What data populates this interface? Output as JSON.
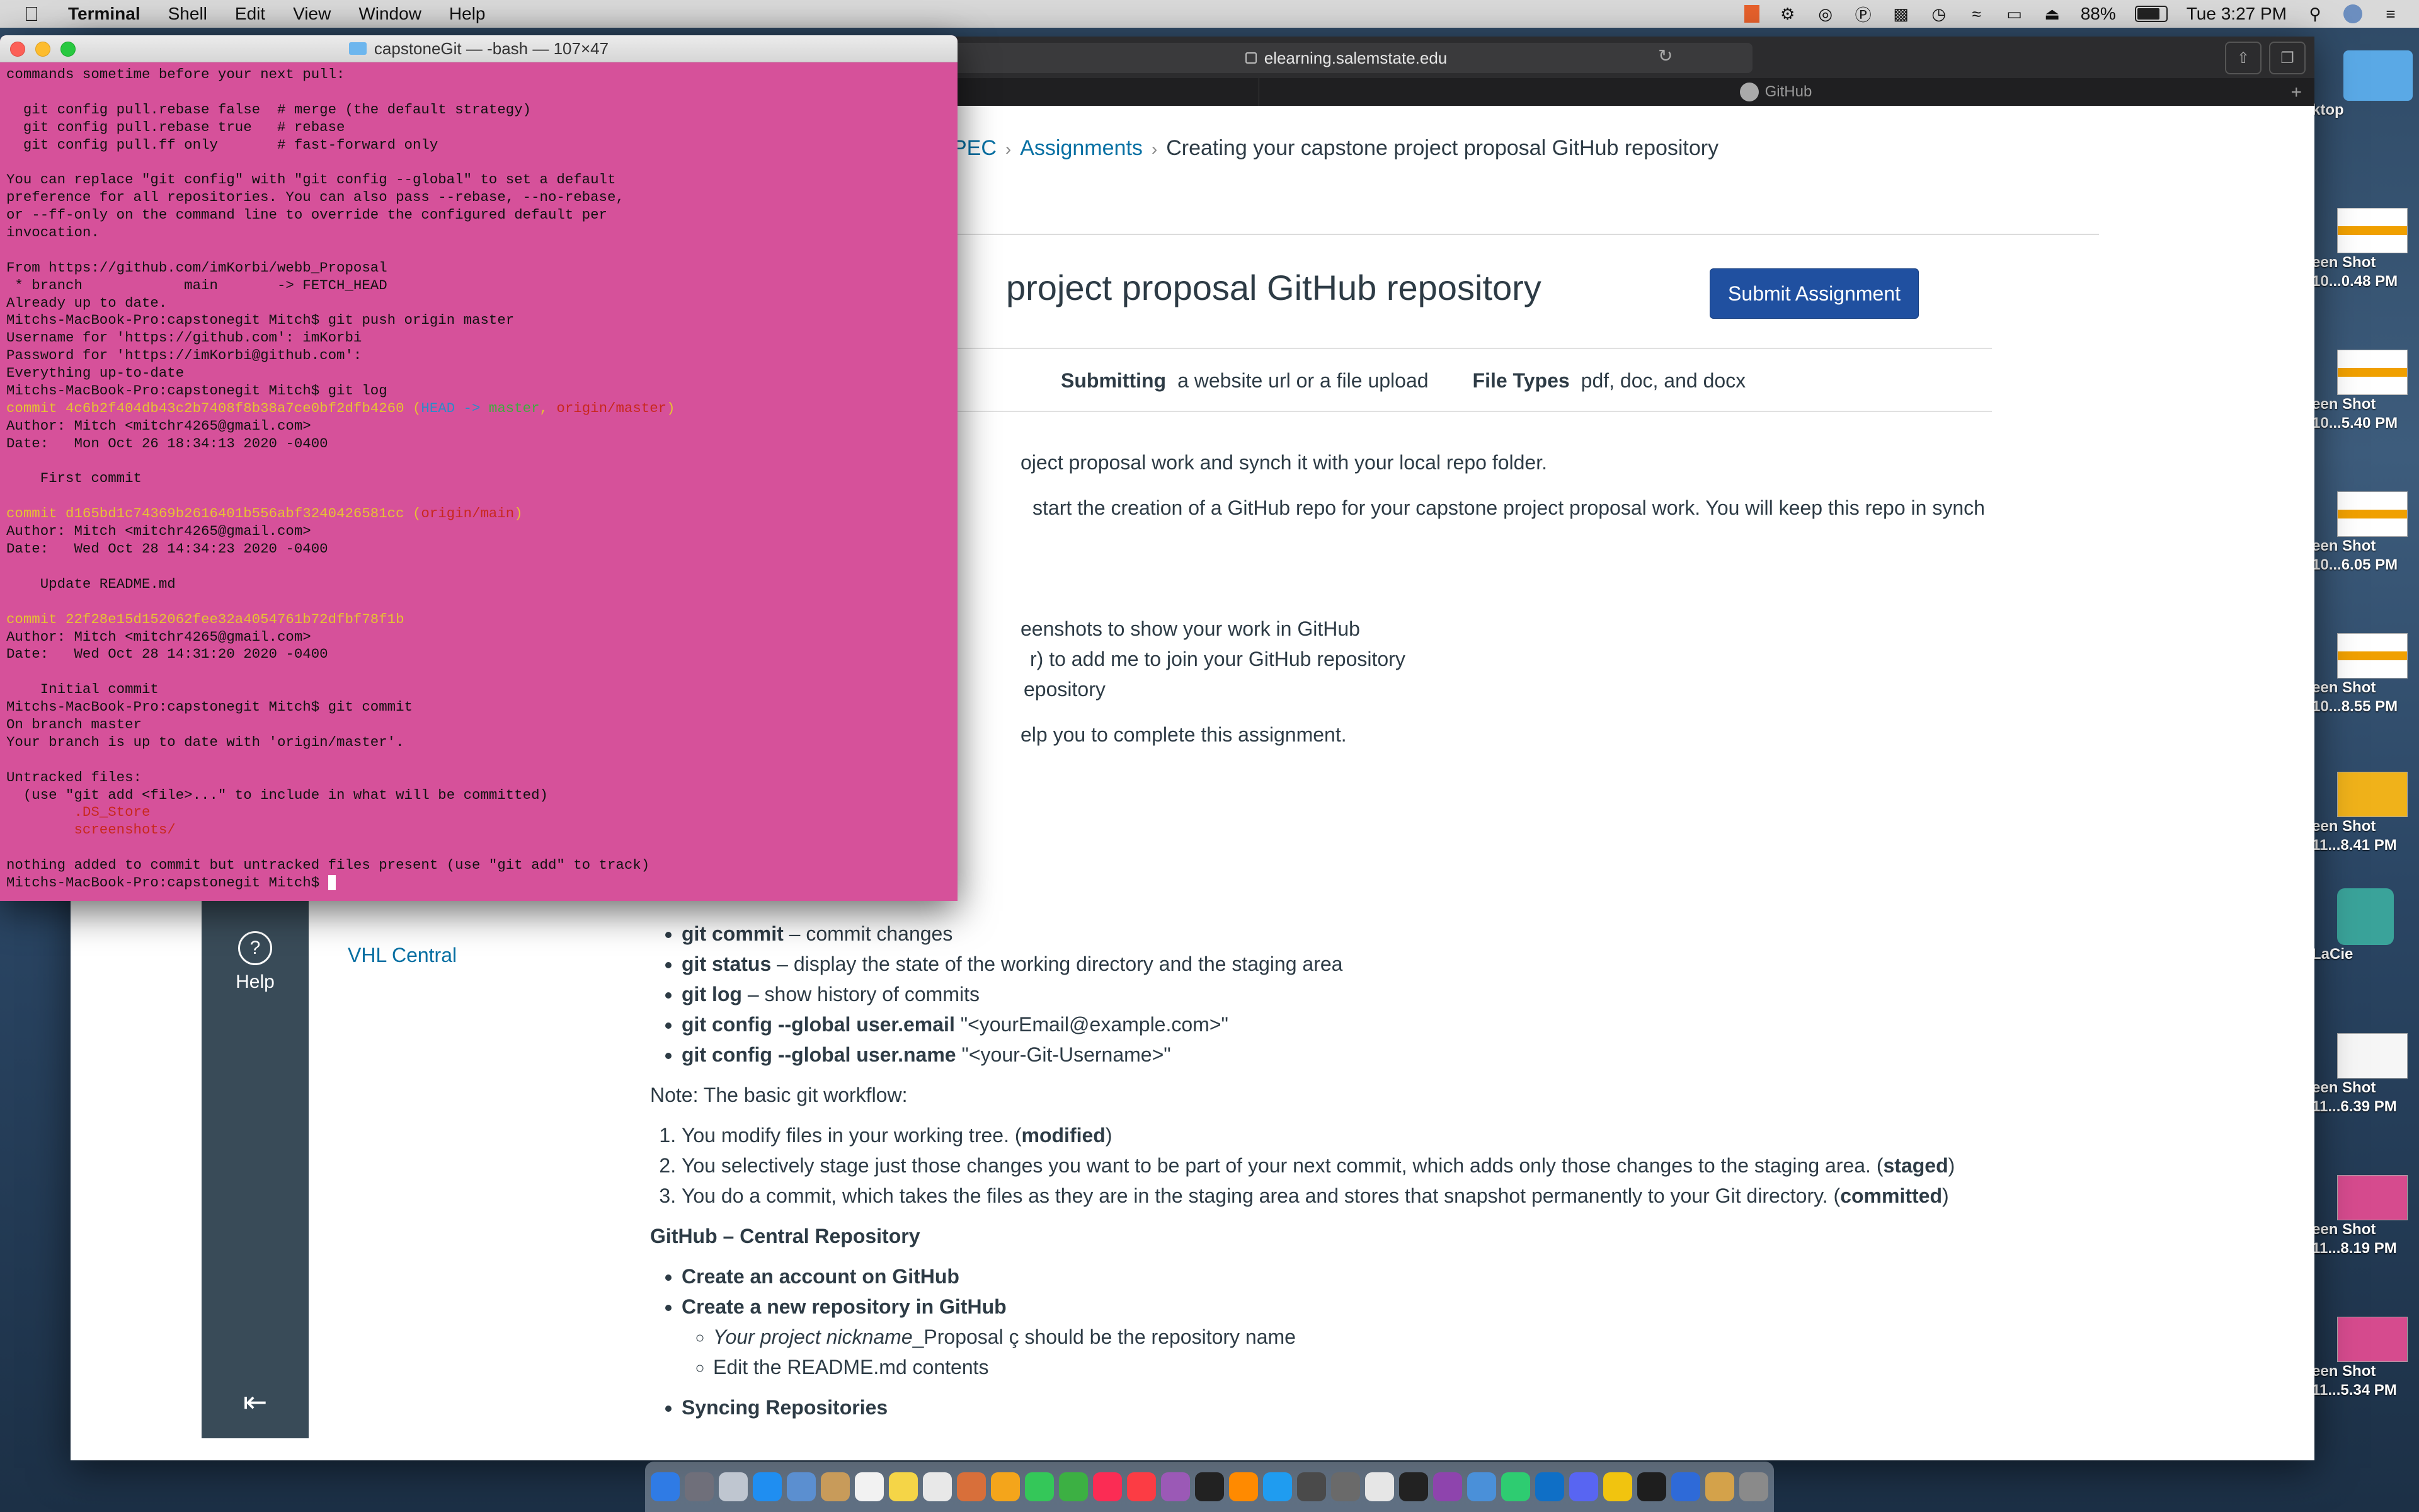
{
  "menubar": {
    "app": "Terminal",
    "items": [
      "Shell",
      "Edit",
      "View",
      "Window",
      "Help"
    ],
    "battery": "88%",
    "battery_level": 0.88,
    "clock": "Tue 3:27 PM"
  },
  "browser": {
    "url": "elearning.salemstate.edu",
    "tabs": [
      "",
      "GitHub"
    ]
  },
  "canvas": {
    "breadcrumb": [
      "PEC",
      "Assignments",
      "Creating your capstone project proposal GitHub repository"
    ],
    "title": "project proposal GitHub repository",
    "submit_button": "Submit Assignment",
    "meta": {
      "submitting_label": "Submitting",
      "submitting_value": "a website url or a file upload",
      "filetypes_label": "File Types",
      "filetypes_value": "pdf, doc, and docx"
    },
    "visible_lines": [
      "oject proposal work and synch it with your local repo folder.",
      "start the creation of a GitHub repo for your capstone project proposal work. You will keep this repo in synch",
      "eenshots to show your work in GitHub",
      "r) to add me to join your GitHub repository",
      "epository",
      "elp you to complete this assignment."
    ],
    "help_label": "Help",
    "course_nav_item": "VHL Central",
    "commands": [
      {
        "cmd": "git commit",
        "desc": " – commit changes"
      },
      {
        "cmd": "git status",
        "desc": " – display the state of the working directory and the staging area"
      },
      {
        "cmd": "git log",
        "desc": " – show history of commits"
      },
      {
        "cmd": "git config --global user.email",
        "desc": " \"<yourEmail@example.com>\""
      },
      {
        "cmd": "git config --global user.name",
        "desc": " \"<your-Git-Username>\""
      }
    ],
    "note": "Note: The basic git workflow:",
    "workflow": [
      {
        "text": "You modify files in your working tree. (",
        "bold": "modified",
        "end": ")"
      },
      {
        "text": "You selectively stage just those changes you want to be part of your next commit, which adds only those changes to the staging area. (",
        "bold": "staged",
        "end": ")"
      },
      {
        "text": "You do a commit, which takes the files as they are in the staging area and stores that snapshot permanently to your Git directory. (",
        "bold": "committed",
        "end": ")"
      }
    ],
    "central_heading": "GitHub – Central Repository",
    "github_items": [
      "Create an account on GitHub",
      "Create a new repository in GitHub"
    ],
    "github_subitems": [
      {
        "em": "Your project nickname",
        "text": "_Proposal ç should be the repository name"
      },
      {
        "em": "",
        "text": "Edit the README.md contents"
      }
    ],
    "syncing": "Syncing Repositories"
  },
  "terminal": {
    "title": "capstoneGit — -bash — 107×47",
    "lines": [
      [
        {
          "t": "commands sometime before your next pull:"
        }
      ],
      [
        {
          "t": ""
        }
      ],
      [
        {
          "t": "  git config pull.rebase false  # merge (the default strategy)"
        }
      ],
      [
        {
          "t": "  git config pull.rebase true   # rebase"
        }
      ],
      [
        {
          "t": "  git config pull.ff only       # fast-forward only"
        }
      ],
      [
        {
          "t": ""
        }
      ],
      [
        {
          "t": "You can replace \"git config\" with \"git config --global\" to set a default"
        }
      ],
      [
        {
          "t": "preference for all repositories. You can also pass --rebase, --no-rebase,"
        }
      ],
      [
        {
          "t": "or --ff-only on the command line to override the configured default per"
        }
      ],
      [
        {
          "t": "invocation."
        }
      ],
      [
        {
          "t": ""
        }
      ],
      [
        {
          "t": "From https://github.com/imKorbi/webb_Proposal"
        }
      ],
      [
        {
          "t": " * branch            main       -> FETCH_HEAD"
        }
      ],
      [
        {
          "t": "Already up to date."
        }
      ],
      [
        {
          "t": "Mitchs-MacBook-Pro:capstonegit Mitch$ git push origin master"
        }
      ],
      [
        {
          "t": "Username for 'https://github.com': imKorbi"
        }
      ],
      [
        {
          "t": "Password for 'https://imKorbi@github.com':"
        }
      ],
      [
        {
          "t": "Everything up-to-date"
        }
      ],
      [
        {
          "t": "Mitchs-MacBook-Pro:capstonegit Mitch$ git log"
        }
      ],
      [
        {
          "t": "commit 4c6b2f404db43c2b7408f8b38a7ce0bf2dfb4260 (",
          "c": "yellow"
        },
        {
          "t": "HEAD -> ",
          "c": "cyan"
        },
        {
          "t": "master",
          "c": "green"
        },
        {
          "t": ", ",
          "c": "yellow"
        },
        {
          "t": "origin/master",
          "c": "red"
        },
        {
          "t": ")",
          "c": "yellow"
        }
      ],
      [
        {
          "t": "Author: Mitch <mitchr4265@gmail.com>"
        }
      ],
      [
        {
          "t": "Date:   Mon Oct 26 18:34:13 2020 -0400"
        }
      ],
      [
        {
          "t": ""
        }
      ],
      [
        {
          "t": "    First commit"
        }
      ],
      [
        {
          "t": ""
        }
      ],
      [
        {
          "t": "commit d165bd1c74369b2616401b556abf3240426581cc (",
          "c": "yellow"
        },
        {
          "t": "origin/main",
          "c": "red"
        },
        {
          "t": ")",
          "c": "yellow"
        }
      ],
      [
        {
          "t": "Author: Mitch <mitchr4265@gmail.com>"
        }
      ],
      [
        {
          "t": "Date:   Wed Oct 28 14:34:23 2020 -0400"
        }
      ],
      [
        {
          "t": ""
        }
      ],
      [
        {
          "t": "    Update README.md"
        }
      ],
      [
        {
          "t": ""
        }
      ],
      [
        {
          "t": "commit 22f28e15d152062fee32a4054761b72dfbf78f1b",
          "c": "yellow"
        }
      ],
      [
        {
          "t": "Author: Mitch <mitchr4265@gmail.com>"
        }
      ],
      [
        {
          "t": "Date:   Wed Oct 28 14:31:20 2020 -0400"
        }
      ],
      [
        {
          "t": ""
        }
      ],
      [
        {
          "t": "    Initial commit"
        }
      ],
      [
        {
          "t": "Mitchs-MacBook-Pro:capstonegit Mitch$ git commit"
        }
      ],
      [
        {
          "t": "On branch master"
        }
      ],
      [
        {
          "t": "Your branch is up to date with 'origin/master'."
        }
      ],
      [
        {
          "t": ""
        }
      ],
      [
        {
          "t": "Untracked files:"
        }
      ],
      [
        {
          "t": "  (use \"git add <file>...\" to include in what will be committed)"
        }
      ],
      [
        {
          "t": "        .DS_Store",
          "c": "red"
        }
      ],
      [
        {
          "t": "        screenshots/",
          "c": "red"
        }
      ],
      [
        {
          "t": ""
        }
      ],
      [
        {
          "t": "nothing added to commit but untracked files present (use \"git add\" to track)"
        }
      ],
      [
        {
          "t": "Mitchs-MacBook-Pro:capstonegit Mitch$ "
        },
        {
          "cursor": true
        }
      ]
    ]
  },
  "desktop": {
    "items": [
      {
        "label": "ktop",
        "kind": "folder"
      },
      {
        "label": "een Shot\n10...0.48 PM",
        "kind": "orange"
      },
      {
        "label": "een Shot\n10...5.40 PM",
        "kind": "orange"
      },
      {
        "label": "een Shot\n10...6.05 PM",
        "kind": "orange"
      },
      {
        "label": "een Shot\n10...8.55 PM",
        "kind": "orange"
      },
      {
        "label": "een Shot\n11...8.41 PM",
        "kind": "gold"
      },
      {
        "label": "LaCie",
        "kind": "drive"
      },
      {
        "label": "een Shot\n11...6.39 PM",
        "kind": "doc"
      },
      {
        "label": "een Shot\n11...8.19 PM",
        "kind": "pink"
      },
      {
        "label": "een Shot\n11...5.34 PM",
        "kind": "pink"
      }
    ]
  },
  "dock": {
    "app_colors": [
      "#2f7be5",
      "#6f6f7a",
      "#bfc6d0",
      "#1f8ef1",
      "#5b8fd0",
      "#c89b5a",
      "#f2f2f2",
      "#f5d547",
      "#e8e8e8",
      "#d86f3a",
      "#f4a51b",
      "#34c759",
      "#3cb043",
      "#fb2c54",
      "#fc3c44",
      "#9b59b6",
      "#222222",
      "#ff8a00",
      "#1f9cf0",
      "#4a4a4a",
      "#6a6a6a",
      "#e6e6e6",
      "#222222",
      "#8e44ad",
      "#4a90d9",
      "#2ecc71",
      "#0f6fc6",
      "#5865f2",
      "#f1c40f",
      "#1e1e1e",
      "#2e6ad8",
      "#d4a24a",
      "#8a8a8a"
    ]
  }
}
